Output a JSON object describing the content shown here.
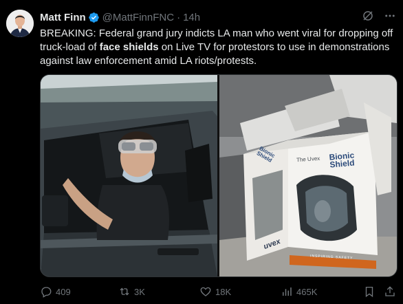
{
  "author": {
    "name": "Matt Finn",
    "handle": "@MattFinnFNC",
    "separator": "·",
    "time": "14h"
  },
  "tweet": {
    "text_before": "BREAKING:  Federal grand jury indicts LA man who went viral for dropping off truck-load of ",
    "text_bold": "face shields",
    "text_after": " on Live TV for protestors to use in demonstrations against law enforcement amid LA riots/protests."
  },
  "media": {
    "box_brand": "The Uvex",
    "box_title": "Bionic Shield",
    "box_spine": "Bionic Shield",
    "box_logo": "uvex",
    "box_tagline": "INSPIRING SAFETY"
  },
  "actions": {
    "replies": "409",
    "reposts": "3K",
    "likes": "18K",
    "views": "465K"
  },
  "colors": {
    "background": "#000000",
    "text": "#e7e9ea",
    "muted": "#71767b",
    "verified": "#1d9bf0"
  }
}
